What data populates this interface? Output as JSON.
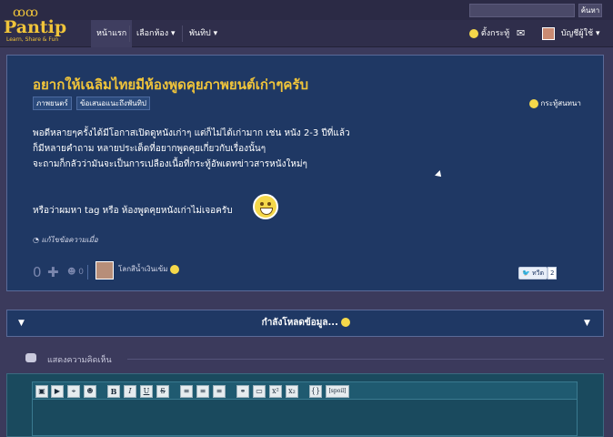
{
  "header": {
    "search_button": "ค้นหา",
    "logo_sub": "Learn, Share & Fun",
    "logo_text": "Pantip",
    "nav": [
      "หน้าแรก",
      "เลือกห้อง ▾",
      "พันทิป ▾"
    ],
    "post_kratoo": "ตั้งกระทู้",
    "account": "บัญชีผู้ใช้ ▾"
  },
  "post": {
    "title": "อยากให้เฉลิมไทยมีห้องพูดคุยภาพยนต์เก่าๆครับ",
    "tags": [
      "ภาพยนตร์",
      "ข้อเสนอแนะถึงพันทิป"
    ],
    "type": "กระทู้สนทนา",
    "body": [
      "พอดีหลายๆครั้งได้มีโอกาสเปิดดูหนังเก่าๆ แต่ก็ไม่ได้เก่ามาก เช่น หนัง 2-3 ปีที่แล้ว",
      "ก็มีหลายคำถาม หลายประเด็ดที่อยากพูดคุยเกี่ยวกับเรื่องนั้นๆ",
      "จะถามก็กลัวว่ามันจะเป็นการเปลืองเนื้อที่กระทู้อัพเดทข่าวสารหนังใหม่ๆ"
    ],
    "body2": "หรือว่าผมหา tag หรือ ห้องพูดคุยหนังเก่าไม่เจอครับ",
    "report": "แก้ไขข้อความเมื่อ",
    "votes": "0",
    "emotions": "0",
    "author": "โลกสีน้ำเงินเข้ม",
    "tweet": "ทวีต",
    "tweet_count": "2"
  },
  "loading": {
    "text": "กำลังโหลดข้อมูล..."
  },
  "comments": {
    "heading": "แสดงความคิดเห็น"
  },
  "toolbar": {
    "tools": [
      "▣",
      "▶",
      "⌖",
      "☻",
      "B",
      "I",
      "U",
      "S",
      "≡",
      "≡",
      "≡",
      "⚭",
      "▭",
      "x²",
      "x₂",
      "{}",
      "[spoil]"
    ]
  }
}
